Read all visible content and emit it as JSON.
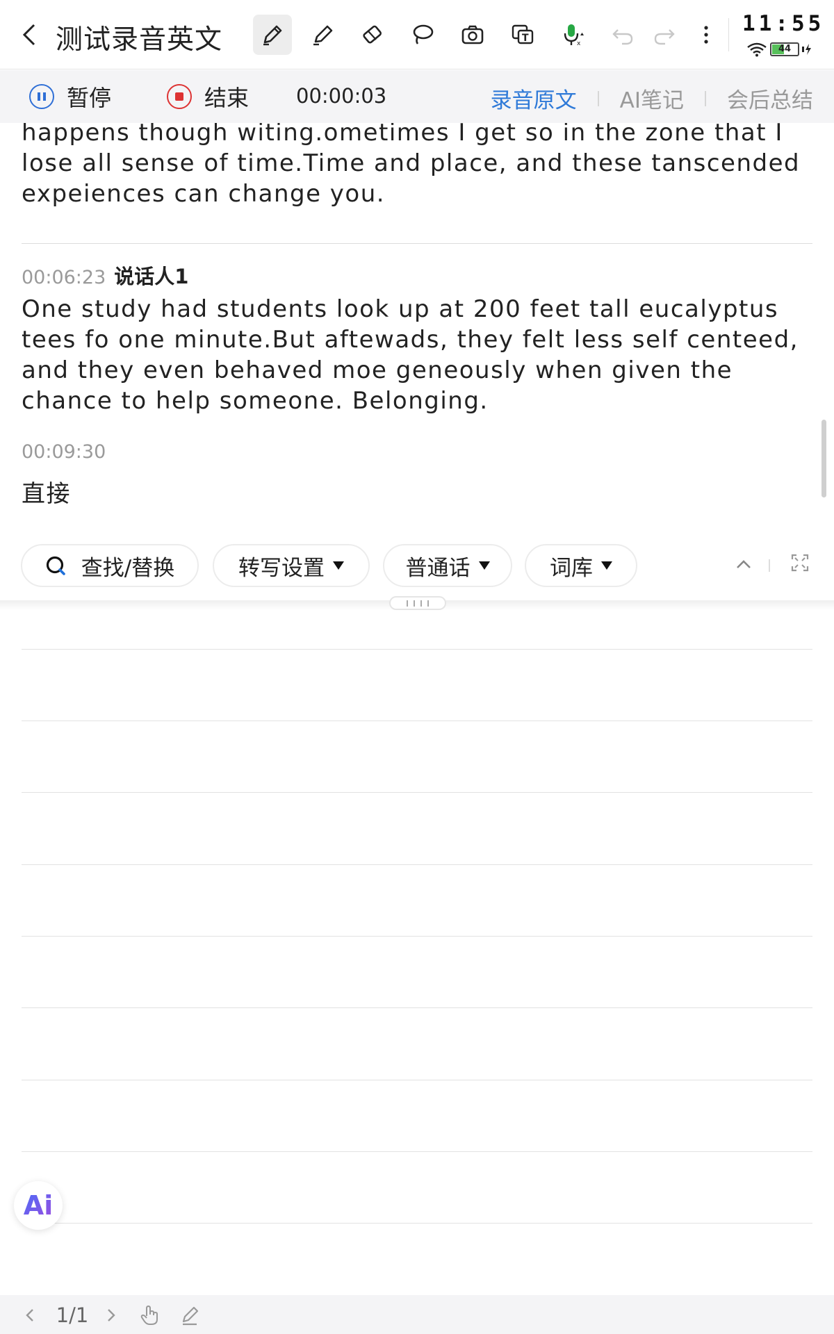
{
  "header": {
    "title": "测试录音英文",
    "clock": "11:55",
    "battery_level": "44"
  },
  "toolbar": {
    "icons": [
      "back-icon",
      "pen-icon",
      "highlighter-icon",
      "eraser-icon",
      "lasso-icon",
      "camera-icon",
      "text-recognize-icon",
      "mic-icon",
      "undo-icon",
      "redo-icon",
      "more-icon"
    ]
  },
  "recording": {
    "pause_label": "暂停",
    "end_label": "结束",
    "timer": "00:00:03",
    "tabs": [
      {
        "label": "录音原文",
        "active": true
      },
      {
        "label": "AI笔记",
        "active": false
      },
      {
        "label": "会后总结",
        "active": false
      }
    ]
  },
  "transcript": {
    "partial_text": "happens though witing.ometimes I get so in the zone that I lose all sense of time.Time and place, and these tanscended expeiences can change you.",
    "segments": [
      {
        "timestamp": "00:06:23",
        "speaker": "说话人1",
        "text": "One study had students look up at 200 feet tall eucalyptus tees fo one minute.But aftewads, they felt less self centeed, and they even behaved moe geneously when given the chance to help someone. Belonging."
      },
      {
        "timestamp": "00:09:30",
        "speaker": "",
        "text": "直接"
      }
    ]
  },
  "actions": {
    "find_replace": "查找/替换",
    "transcribe_settings": "转写设置",
    "language": "普通话",
    "lexicon": "词库"
  },
  "ai_button": "Ai",
  "footer": {
    "page_indicator": "1/1"
  }
}
